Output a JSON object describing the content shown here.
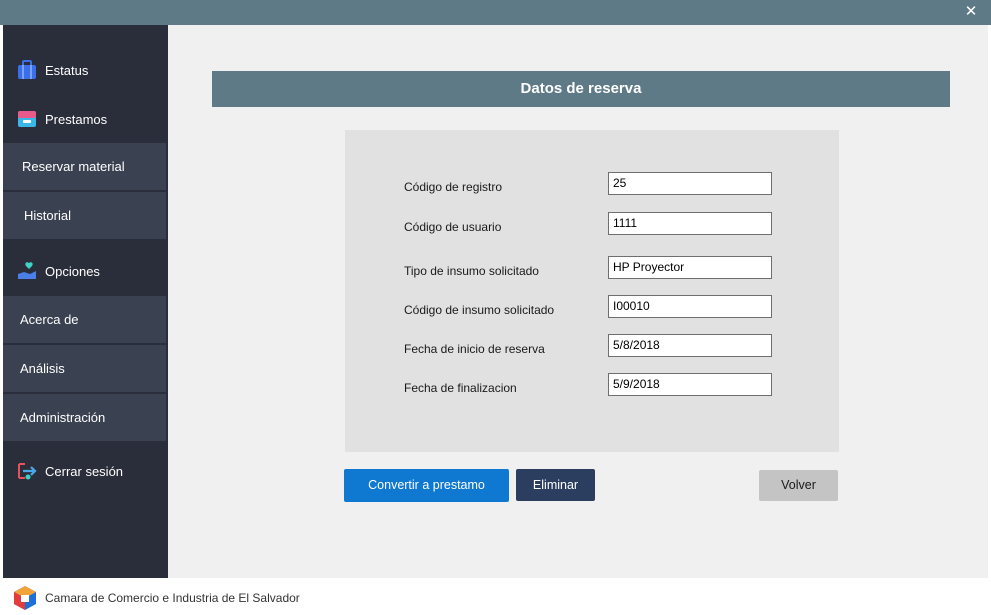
{
  "window": {
    "close_glyph": "✕"
  },
  "sidebar": {
    "sections": [
      {
        "label": "Estatus",
        "icon": "briefcase-icon",
        "color": "#3a6fe8"
      },
      {
        "label": "Prestamos",
        "icon": "inbox-icon",
        "color": "#39b7e6"
      },
      {
        "label": "Opciones",
        "icon": "hand-heart-icon",
        "color": "#4aa8e8"
      },
      {
        "label": "Cerrar sesión",
        "icon": "logout-icon",
        "color": "#4aa8e8"
      }
    ],
    "items": [
      {
        "label": "Reservar material"
      },
      {
        "label": "Historial"
      },
      {
        "label": "Acerca de"
      },
      {
        "label": "Análisis"
      },
      {
        "label": "Administración"
      }
    ]
  },
  "main": {
    "header": "Datos de reserva",
    "fields": [
      {
        "label": "Código de registro",
        "value": "25"
      },
      {
        "label": "Código de usuario",
        "value": "1111"
      },
      {
        "label": "Tipo de insumo solicitado",
        "value": "HP Proyector"
      },
      {
        "label": "Código de insumo solicitado",
        "value": "I00010"
      },
      {
        "label": "Fecha de inicio de reserva",
        "value": "5/8/2018"
      },
      {
        "label": "Fecha de finalizacion",
        "value": "5/9/2018"
      }
    ],
    "buttons": {
      "convert": "Convertir a prestamo",
      "delete": "Eliminar",
      "back": "Volver"
    }
  },
  "footer": {
    "text": "Camara de Comercio e Industria de El Salvador"
  },
  "colors": {
    "accent": "#0f78d0",
    "header": "#5f7a87",
    "sidebar": "#2a2e3a"
  }
}
